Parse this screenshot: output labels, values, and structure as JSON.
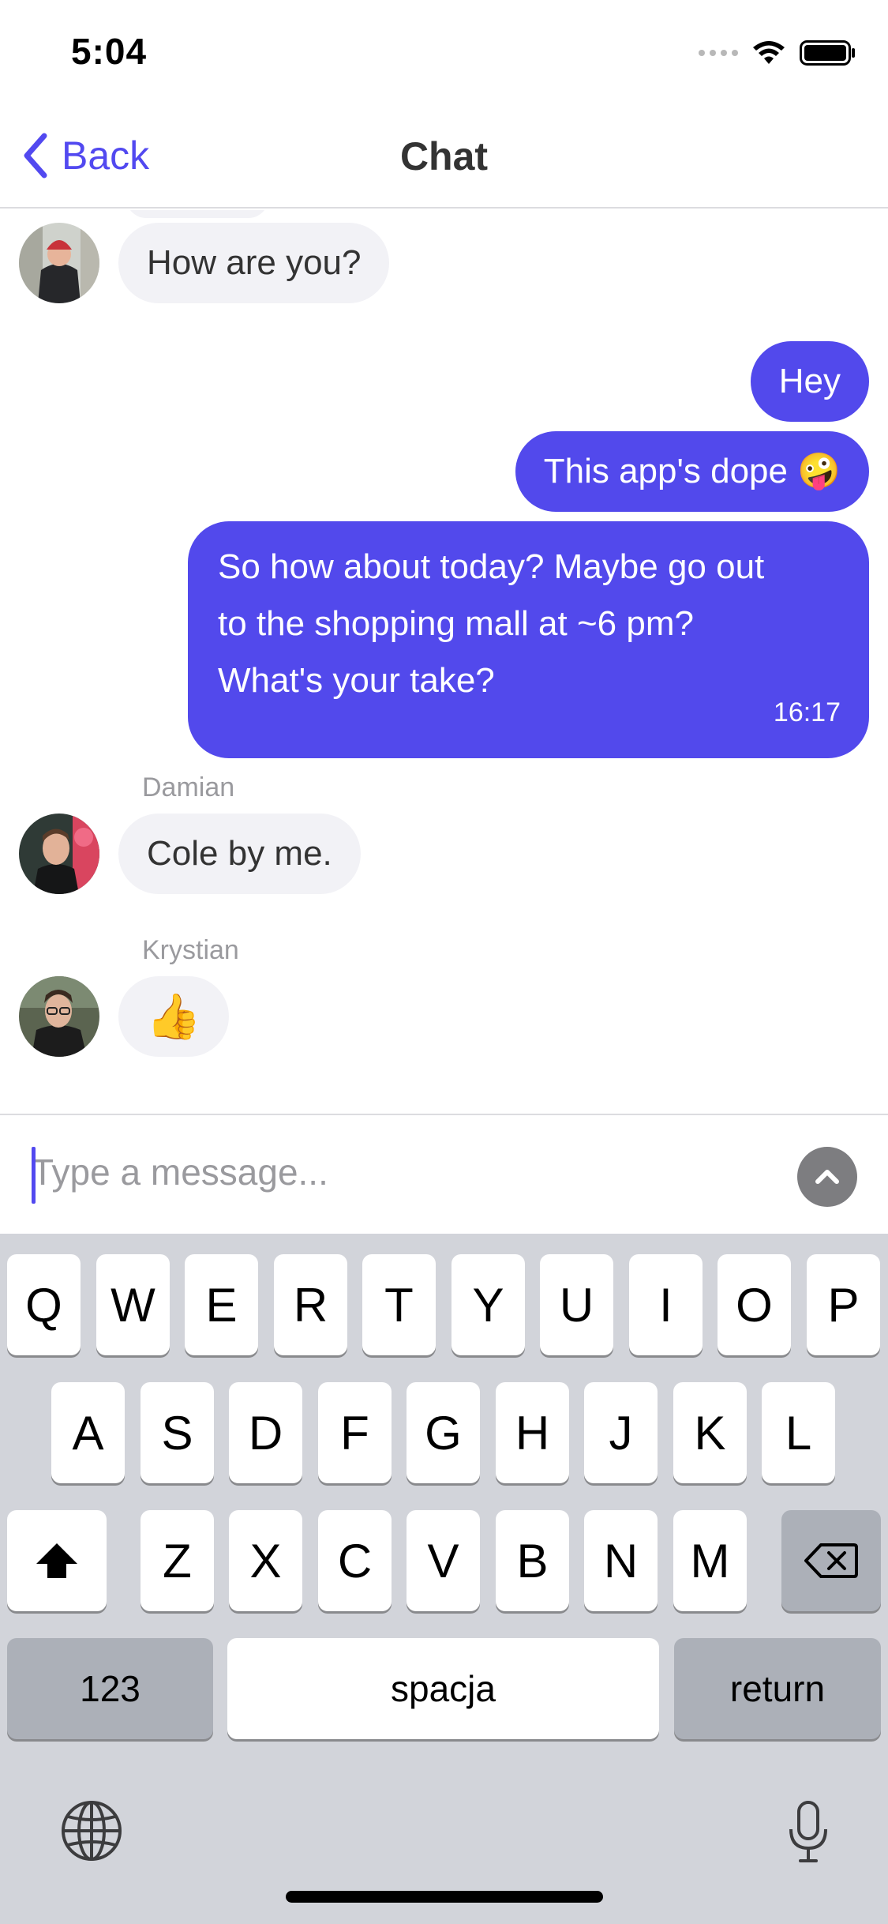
{
  "status_bar": {
    "time": "5:04"
  },
  "nav": {
    "back_label": "Back",
    "title": "Chat"
  },
  "messages": [
    {
      "text": "How are you?",
      "direction": "incoming"
    },
    {
      "text": "Hey",
      "direction": "outgoing"
    },
    {
      "text": "This app's dope 🤪",
      "direction": "outgoing"
    },
    {
      "lines": [
        "So how about today? Maybe go out",
        "to the shopping mall at ~6 pm?",
        "What's your take?"
      ],
      "time": "16:17",
      "direction": "outgoing"
    },
    {
      "sender": "Damian",
      "text": "Cole by me.",
      "direction": "incoming"
    },
    {
      "sender": "Krystian",
      "text": "👍",
      "direction": "incoming"
    }
  ],
  "composer": {
    "placeholder": "Type a message..."
  },
  "keyboard": {
    "row1": [
      "Q",
      "W",
      "E",
      "R",
      "T",
      "Y",
      "U",
      "I",
      "O",
      "P"
    ],
    "row2": [
      "A",
      "S",
      "D",
      "F",
      "G",
      "H",
      "J",
      "K",
      "L"
    ],
    "row3": [
      "Z",
      "X",
      "C",
      "V",
      "B",
      "N",
      "M"
    ],
    "numbers_label": "123",
    "space_label": "spacja",
    "return_label": "return"
  },
  "colors": {
    "accent": "#5249ec",
    "incoming_bubble": "#f2f2f6",
    "keyboard_bg": "#d2d4da"
  },
  "icons": [
    "back-chevron-icon",
    "wifi-icon",
    "battery-icon",
    "send-arrow-icon",
    "shift-icon",
    "backspace-icon",
    "globe-icon",
    "microphone-icon"
  ]
}
